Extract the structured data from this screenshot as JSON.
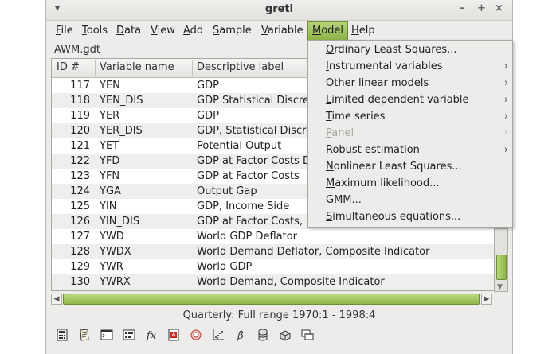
{
  "window": {
    "title": "gretl",
    "menu_glyph": "▾",
    "minimize": "–",
    "maximize": "+",
    "close": "×"
  },
  "menubar": {
    "items": [
      {
        "label": "File",
        "ul": "F",
        "rest": "ile"
      },
      {
        "label": "Tools",
        "ul": "T",
        "rest": "ools"
      },
      {
        "label": "Data",
        "ul": "D",
        "rest": "ata"
      },
      {
        "label": "View",
        "ul": "V",
        "rest": "iew"
      },
      {
        "label": "Add",
        "ul": "A",
        "rest": "dd"
      },
      {
        "label": "Sample",
        "ul": "S",
        "rest": "ample"
      },
      {
        "label": "Variable",
        "ul": "V",
        "rest": "ariable"
      },
      {
        "label": "Model",
        "ul": "M",
        "rest": "odel"
      },
      {
        "label": "Help",
        "ul": "H",
        "rest": "elp"
      }
    ]
  },
  "dataset": {
    "filename": "AWM.gdt"
  },
  "table": {
    "columns": [
      "ID #",
      "Variable name",
      "Descriptive label"
    ],
    "rows": [
      {
        "id": "117",
        "name": "YEN",
        "label": "GDP"
      },
      {
        "id": "118",
        "name": "YEN_DIS",
        "label": "GDP Statistical Discre"
      },
      {
        "id": "119",
        "name": "YER",
        "label": "GDP"
      },
      {
        "id": "120",
        "name": "YER_DIS",
        "label": "GDP, Statistical Discre"
      },
      {
        "id": "121",
        "name": "YET",
        "label": "Potential Output"
      },
      {
        "id": "122",
        "name": "YFD",
        "label": "GDP at Factor Costs D"
      },
      {
        "id": "123",
        "name": "YFN",
        "label": "GDP at Factor Costs"
      },
      {
        "id": "124",
        "name": "YGA",
        "label": "Output Gap"
      },
      {
        "id": "125",
        "name": "YIN",
        "label": "GDP, Income Side"
      },
      {
        "id": "126",
        "name": "YIN_DIS",
        "label": "GDP at Factor Costs, S"
      },
      {
        "id": "127",
        "name": "YWD",
        "label": "World GDP Deflator"
      },
      {
        "id": "128",
        "name": "YWDX",
        "label": "World Demand Deflator, Composite Indicator"
      },
      {
        "id": "129",
        "name": "YWR",
        "label": "World GDP"
      },
      {
        "id": "130",
        "name": "YWRX",
        "label": "World Demand, Composite Indicator"
      }
    ]
  },
  "status": {
    "text": "Quarterly: Full range 1970:1 - 1998:4"
  },
  "model_menu": {
    "items": [
      {
        "label": "Ordinary Least Squares...",
        "ul": "O",
        "rest": "rdinary Least Squares...",
        "submenu": "",
        "disabled": false
      },
      {
        "label": "Instrumental variables",
        "ul": "I",
        "rest": "nstrumental variables",
        "submenu": "›",
        "disabled": false
      },
      {
        "label": "Other linear models",
        "ul": "",
        "rest": "Other linear models",
        "submenu": "›",
        "disabled": false
      },
      {
        "label": "Limited dependent variable",
        "ul": "L",
        "rest": "imited dependent variable",
        "submenu": "›",
        "disabled": false
      },
      {
        "label": "Time series",
        "ul": "T",
        "rest": "ime series",
        "submenu": "›",
        "disabled": false
      },
      {
        "label": "Panel",
        "ul": "P",
        "rest": "anel",
        "submenu": "›",
        "disabled": true
      },
      {
        "label": "Robust estimation",
        "ul": "R",
        "rest": "obust estimation",
        "submenu": "›",
        "disabled": false
      },
      {
        "label": "Nonlinear Least Squares...",
        "ul": "N",
        "rest": "onlinear Least Squares...",
        "submenu": "",
        "disabled": false
      },
      {
        "label": "Maximum likelihood...",
        "ul": "M",
        "rest": "aximum likelihood...",
        "submenu": "",
        "disabled": false
      },
      {
        "label": "GMM...",
        "ul": "G",
        "rest": "MM...",
        "submenu": "",
        "disabled": false
      },
      {
        "label": "Simultaneous equations...",
        "ul": "S",
        "rest": "imultaneous equations...",
        "submenu": "",
        "disabled": false
      }
    ]
  },
  "toolbar": {
    "icons": [
      "calculator-icon",
      "notes-icon",
      "terminal-icon",
      "session-icon",
      "function-icon",
      "pdf-help-icon",
      "help-icon",
      "scatter-plot-icon",
      "ols-beta-icon",
      "database-icon",
      "function-package-icon",
      "window-list-icon"
    ],
    "fx_glyph": "fx",
    "beta_glyph": "β̂"
  },
  "colors": {
    "accent": "#9bbd58",
    "accent_border": "#6d8d36",
    "row_alt": "#eeeeec",
    "window_bg": "#edeceb"
  }
}
